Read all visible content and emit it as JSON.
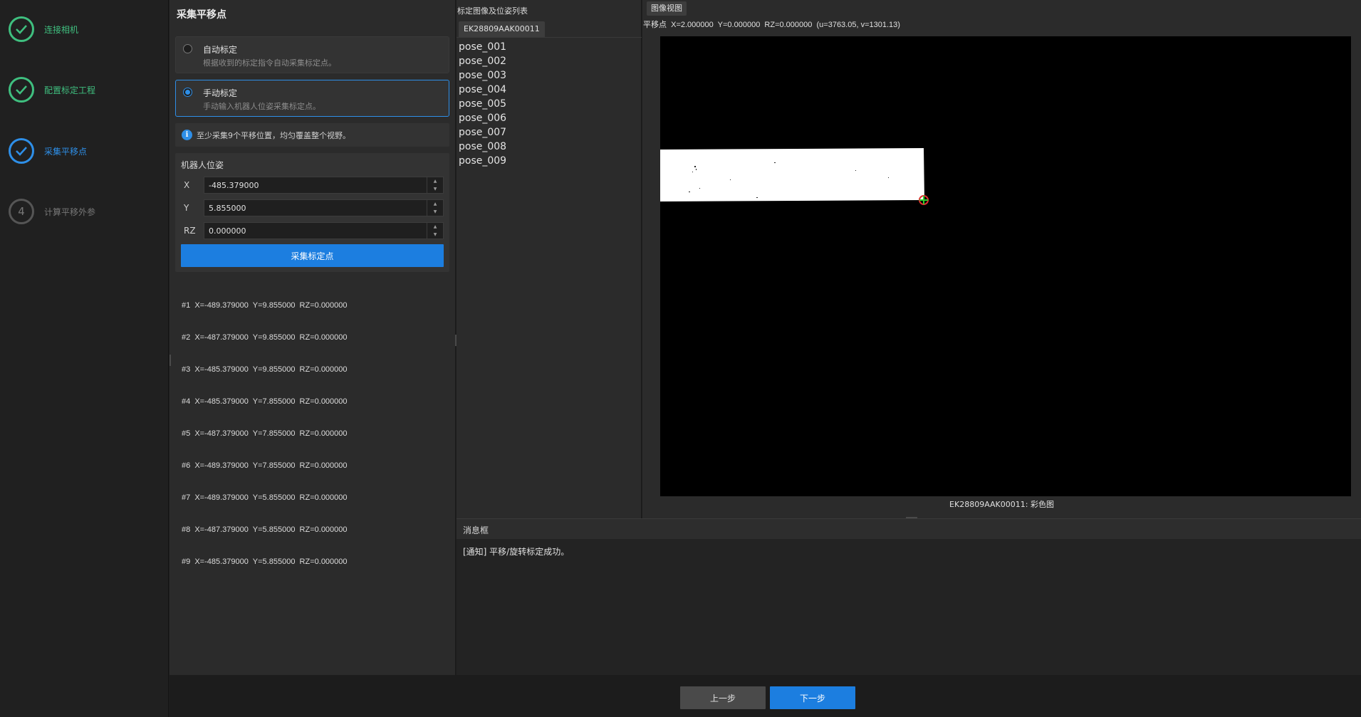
{
  "steps": [
    {
      "label": "连接相机",
      "state": "done"
    },
    {
      "label": "配置标定工程",
      "state": "done"
    },
    {
      "label": "采集平移点",
      "state": "active"
    },
    {
      "label": "计算平移外参",
      "state": "todo",
      "number": "4"
    }
  ],
  "panel": {
    "title": "采集平移点",
    "options": [
      {
        "title": "自动标定",
        "desc": "根据收到的标定指令自动采集标定点。",
        "selected": false
      },
      {
        "title": "手动标定",
        "desc": "手动输入机器人位姿采集标定点。",
        "selected": true
      }
    ],
    "tip": "至少采集9个平移位置，均匀覆盖整个视野。",
    "info_glyph": "i",
    "pose": {
      "title": "机器人位姿",
      "fields": [
        {
          "key": "X",
          "value": "-485.379000"
        },
        {
          "key": "Y",
          "value": "5.855000"
        },
        {
          "key": "RZ",
          "value": "0.000000"
        }
      ],
      "collect_label": "采集标定点"
    },
    "records": [
      "#1  X=-489.379000  Y=9.855000  RZ=0.000000",
      "#2  X=-487.379000  Y=9.855000  RZ=0.000000",
      "#3  X=-485.379000  Y=9.855000  RZ=0.000000",
      "#4  X=-485.379000  Y=7.855000  RZ=0.000000",
      "#5  X=-487.379000  Y=7.855000  RZ=0.000000",
      "#6  X=-489.379000  Y=7.855000  RZ=0.000000",
      "#7  X=-489.379000  Y=5.855000  RZ=0.000000",
      "#8  X=-487.379000  Y=5.855000  RZ=0.000000",
      "#9  X=-485.379000  Y=5.855000  RZ=0.000000"
    ]
  },
  "image_list": {
    "title": "标定图像及位姿列表",
    "tab": "EK28809AAK00011",
    "poses": [
      "pose_001",
      "pose_002",
      "pose_003",
      "pose_004",
      "pose_005",
      "pose_006",
      "pose_007",
      "pose_008",
      "pose_009"
    ]
  },
  "image_view": {
    "tab": "图像视图",
    "coords": "平移点  X=2.000000  Y=0.000000  RZ=0.000000  (u=3763.05, v=1301.13)",
    "caption": "EK28809AAK00011: 彩色图",
    "marker_color": "#e03030",
    "marker_cross_color": "#30d030"
  },
  "messages": {
    "title": "消息框",
    "text": "[通知] 平移/旋转标定成功。"
  },
  "footer": {
    "prev_label": "上一步",
    "next_label": "下一步"
  },
  "colors": {
    "accent": "#1c7ee0",
    "done": "#3fbf7f"
  }
}
